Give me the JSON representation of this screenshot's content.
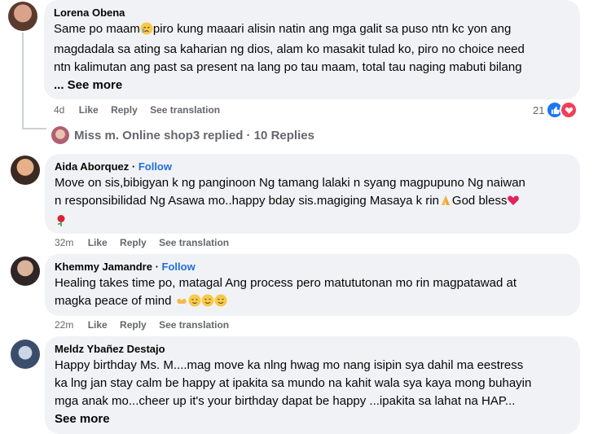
{
  "comments": [
    {
      "author": "Lorena Obena",
      "lines": [
        "Same po maam",
        "piro kung maaari alisin natin ang mga galit sa puso ntn kc yon ang",
        "magdadala sa ating sa kaharian ng dios, alam ko masakit tulad ko, piro no choice need",
        "ntn kalimutan ang past sa present na lang po tau maam, total tau naging mabuti bilang"
      ],
      "see_more": "... See more",
      "time": "4d",
      "like": "Like",
      "reply": "Reply",
      "translate": "See translation",
      "reaction_count": "21",
      "reaction_icons": [
        "like-icon",
        "love-icon"
      ]
    },
    {
      "author": "Aida Aborquez",
      "follow": "Follow",
      "lines": [
        "Move on sis,bibigyan k ng panginoon Ng tamang lalaki n syang magpupuno Ng naiwan",
        "n responsibilidad Ng Asawa mo..happy bday sis.magiging Masaya k rin",
        "God bless"
      ],
      "time": "32m",
      "like": "Like",
      "reply": "Reply",
      "translate": "See translation"
    },
    {
      "author": "Khemmy Jamandre",
      "follow": "Follow",
      "lines": [
        "Healing takes time po, matagal Ang process pero matututonan mo rin magpatawad at",
        "magka peace of mind"
      ],
      "time": "22m",
      "like": "Like",
      "reply": "Reply",
      "translate": "See translation"
    },
    {
      "author": "Meldz Ybañez Destajo",
      "lines": [
        "Happy birthday Ms. M....mag move ka nlng hwag mo nang isipin sya dahil ma eestress",
        "ka lng jan stay calm be happy at ipakita sa mundo na kahit wala sya kaya mong buhayin",
        "mga anak mo...cheer up it's your birthday dapat be happy ...ipakita sa lahat na HAP..."
      ],
      "see_more": "See more"
    }
  ],
  "replies_link": {
    "author": "Miss m. Online shop3",
    "text": "replied · 10 Replies"
  },
  "colors": {
    "bubble": "#f0f2f5",
    "muted": "#65676b",
    "follow": "#216fdb",
    "like_blue": "#1877f2",
    "love_red": "#f33e58"
  }
}
